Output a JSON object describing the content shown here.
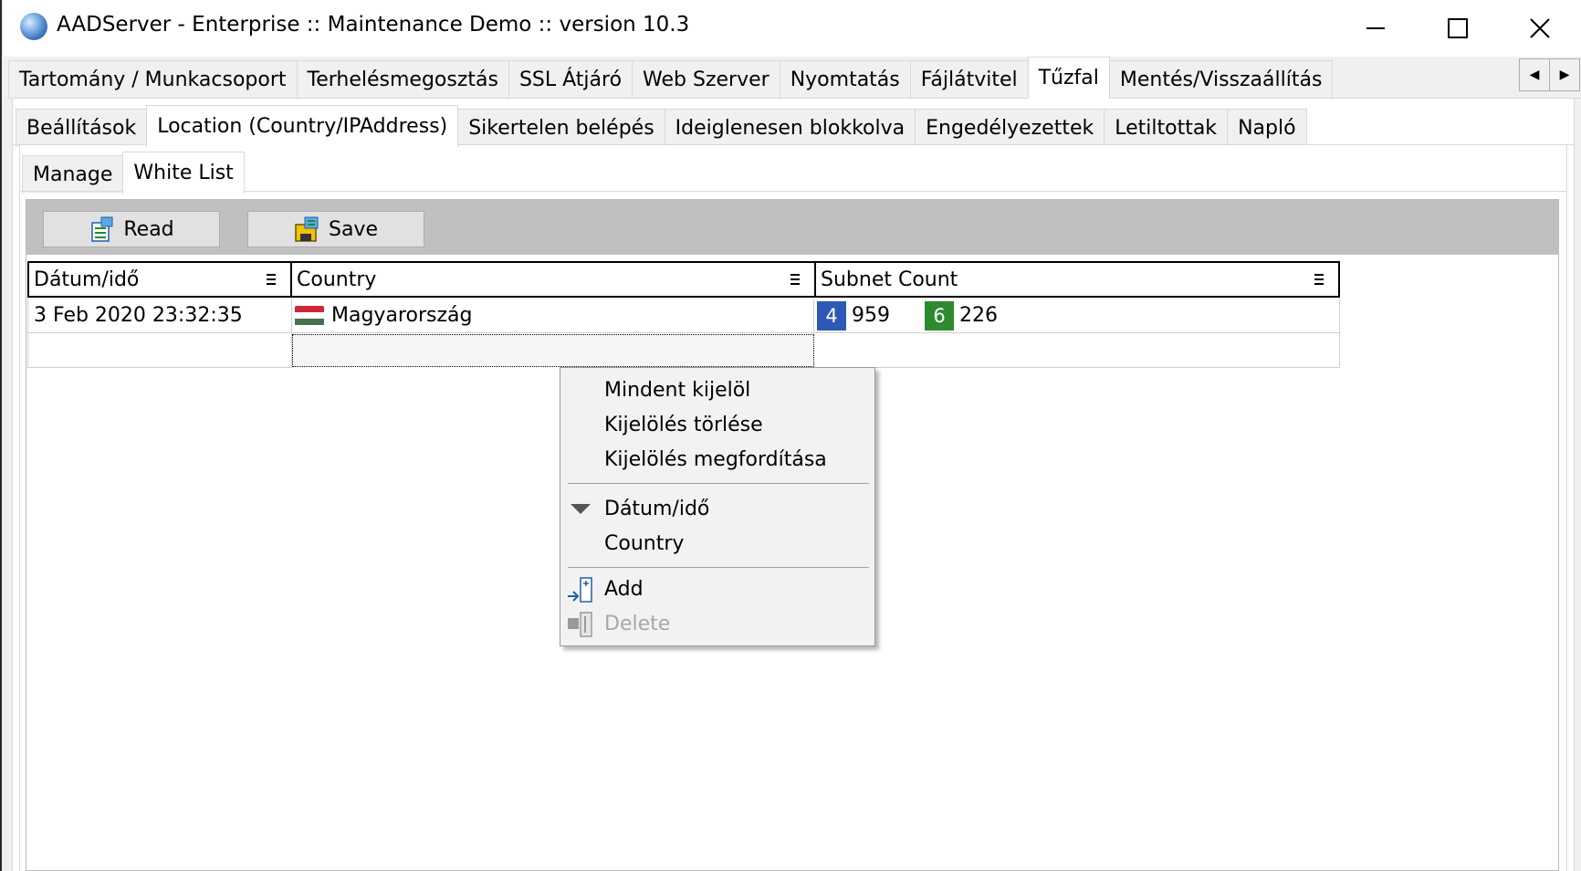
{
  "window": {
    "title": "AADServer - Enterprise :: Maintenance Demo :: version 10.3",
    "controls": {
      "minimize": "—",
      "maximize": "☐",
      "close": "✕"
    }
  },
  "main_tabs": [
    {
      "label": "Tartomány / Munkacsoport"
    },
    {
      "label": "Terhelésmegosztás"
    },
    {
      "label": "SSL Átjáró"
    },
    {
      "label": "Web Szerver"
    },
    {
      "label": "Nyomtatás"
    },
    {
      "label": "Fájlátvitel"
    },
    {
      "label": "Tűzfal",
      "active": true
    },
    {
      "label": "Mentés/Visszaállítás"
    }
  ],
  "tab_scroll": {
    "left": "◀",
    "right": "▶"
  },
  "firewall_tabs": [
    {
      "label": "Beállítások"
    },
    {
      "label": "Location (Country/IPAddress)",
      "active": true
    },
    {
      "label": "Sikertelen belépés"
    },
    {
      "label": "Ideiglenesen blokkolva"
    },
    {
      "label": "Engedélyezettek"
    },
    {
      "label": "Letiltottak"
    },
    {
      "label": "Napló"
    }
  ],
  "location_tabs": [
    {
      "label": "Manage"
    },
    {
      "label": "White List",
      "active": true
    }
  ],
  "toolbar": {
    "read_label": "Read",
    "save_label": "Save",
    "background": "#c0c0c0"
  },
  "grid": {
    "columns": [
      "Dátum/idő",
      "Country",
      "Subnet Count"
    ],
    "rows": [
      {
        "datetime": "3 Feb 2020 23:32:35",
        "country": "Magyarország",
        "ipv4_badge": "4",
        "ipv4_count": "959",
        "ipv6_badge": "6",
        "ipv6_count": "226"
      }
    ],
    "flag_colors": [
      "#ce2939",
      "#ffffff",
      "#477050"
    ],
    "badge_colors": {
      "ipv4": "#2e58b6",
      "ipv6": "#2e8a2e"
    }
  },
  "context_menu": {
    "select_all": "Mindent kijelöl",
    "clear_selection": "Kijelölés törlése",
    "invert_selection": "Kijelölés megfordítása",
    "group_datetime": "Dátum/idő",
    "group_country": "Country",
    "add": "Add",
    "delete": "Delete"
  }
}
